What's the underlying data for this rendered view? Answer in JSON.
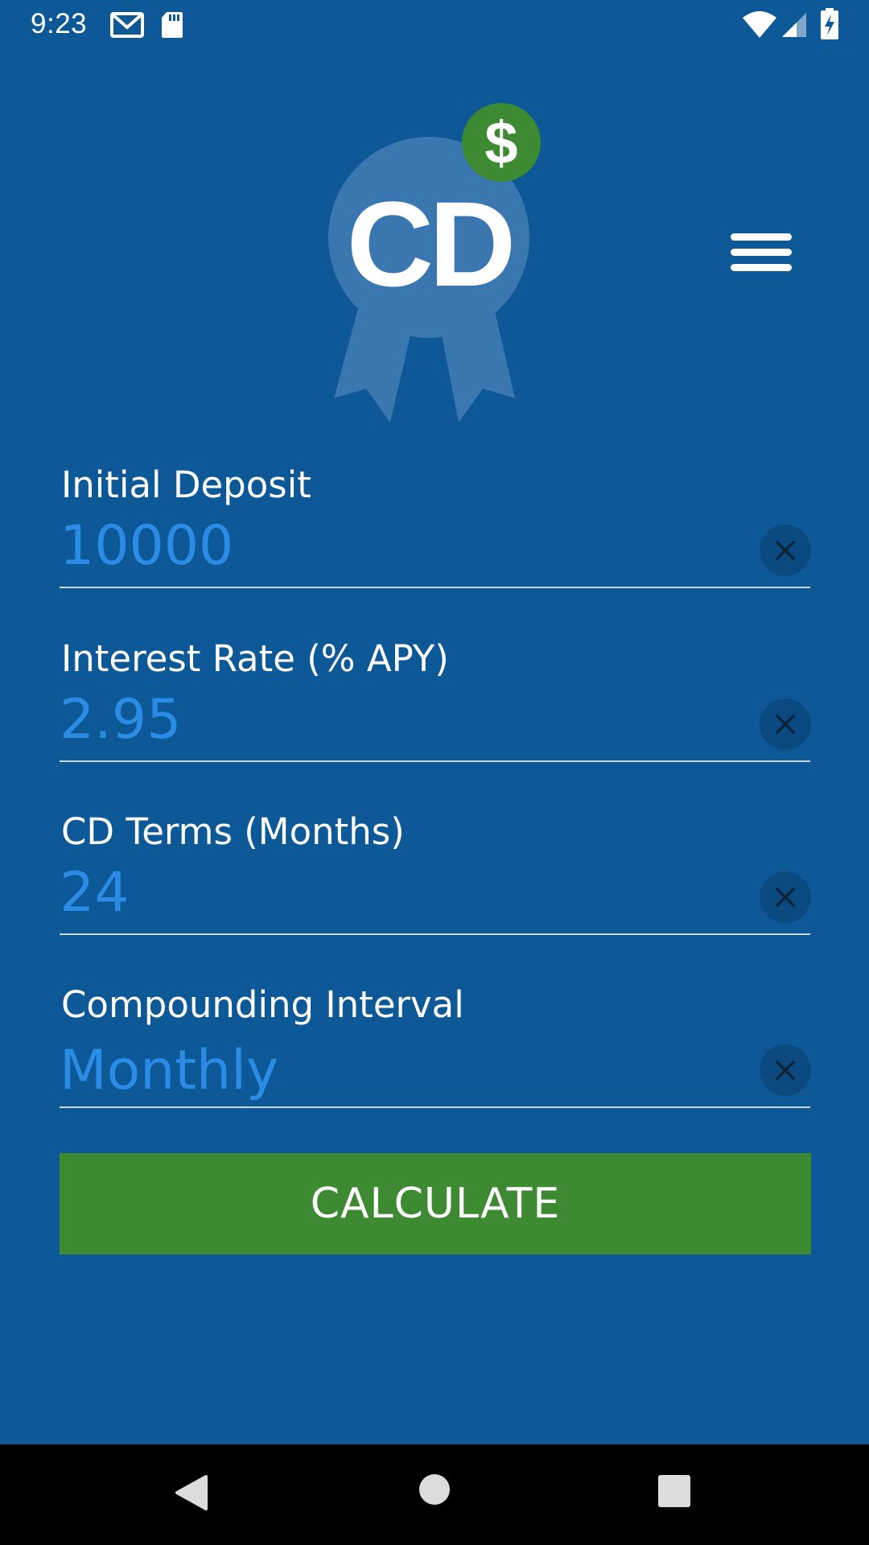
{
  "status_bar": {
    "time": "9:23",
    "icons": [
      "gmail-icon",
      "sd-card-icon",
      "wifi-icon",
      "cell-signal-icon",
      "battery-charging-icon"
    ]
  },
  "header": {
    "logo_text": "CD",
    "logo_badge_symbol": "$",
    "menu_icon": "hamburger-menu-icon"
  },
  "form": {
    "fields": [
      {
        "label": "Initial Deposit",
        "value": "10000"
      },
      {
        "label": "Interest Rate (% APY)",
        "value": "2.95"
      },
      {
        "label": "CD Terms (Months)",
        "value": "24"
      },
      {
        "label": "Compounding Interval",
        "value": "Monthly"
      }
    ],
    "clear_icon": "close-icon",
    "submit_label": "CALCULATE"
  },
  "nav_bar": {
    "icons": [
      "back-icon",
      "home-icon",
      "recents-icon"
    ]
  },
  "colors": {
    "background": "#0d5896",
    "accent_green": "#3e8a33",
    "input_text": "#2b8ce6",
    "logo_ribbon": "#3a77b0"
  }
}
